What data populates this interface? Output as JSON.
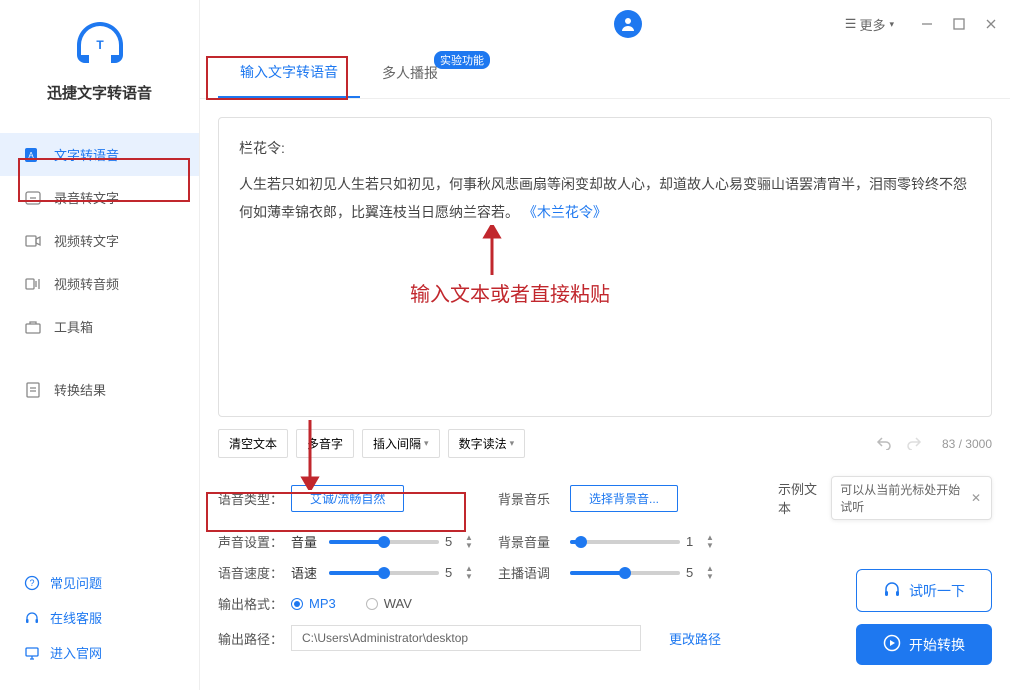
{
  "app": {
    "title": "迅捷文字转语音",
    "more_label": "更多"
  },
  "sidebar": {
    "items": [
      {
        "label": "文字转语音"
      },
      {
        "label": "录音转文字"
      },
      {
        "label": "视频转文字"
      },
      {
        "label": "视频转音频"
      },
      {
        "label": "工具箱"
      },
      {
        "label": "转换结果"
      }
    ],
    "bottom": [
      {
        "label": "常见问题"
      },
      {
        "label": "在线客服"
      },
      {
        "label": "进入官网"
      }
    ]
  },
  "tabs": {
    "input_text": "输入文字转语音",
    "multi_voice": "多人播报",
    "badge": "实验功能"
  },
  "editor": {
    "label": "栏花令:",
    "text": "人生若只如初见人生若只如初见，何事秋风悲画扇等闲变却故人心，却道故人心易变骊山语罢清宵半，泪雨零铃终不怨何如薄幸锦衣郎，比翼连枝当日愿纳兰容若。",
    "link": "《木兰花令》"
  },
  "toolbar": {
    "clear": "清空文本",
    "polyphonic": "多音字",
    "insert_gap": "插入间隔",
    "number_read": "数字读法",
    "char_count": "83 / 3000"
  },
  "settings": {
    "voice_type_label": "语音类型：",
    "voice_type_value": "艾诚/流畅自然",
    "bg_music_label": "背景音乐",
    "bg_music_value": "选择背景音...",
    "sample_label": "示例文本",
    "sample_tip": "可以从当前光标处开始试听",
    "sound_label": "声音设置：",
    "volume_label": "音量",
    "volume_value": "5",
    "bg_volume_label": "背景音量",
    "bg_volume_value": "1",
    "speed_row_label": "语音速度：",
    "speed_label": "语速",
    "speed_value": "5",
    "tone_label": "主播语调",
    "tone_value": "5",
    "format_label": "输出格式：",
    "format_mp3": "MP3",
    "format_wav": "WAV",
    "path_label": "输出路径：",
    "path_value": "C:\\Users\\Administrator\\desktop",
    "change_path": "更改路径"
  },
  "actions": {
    "listen": "试听一下",
    "start": "开始转换"
  },
  "annotation": {
    "hint": "输入文本或者直接粘贴"
  }
}
